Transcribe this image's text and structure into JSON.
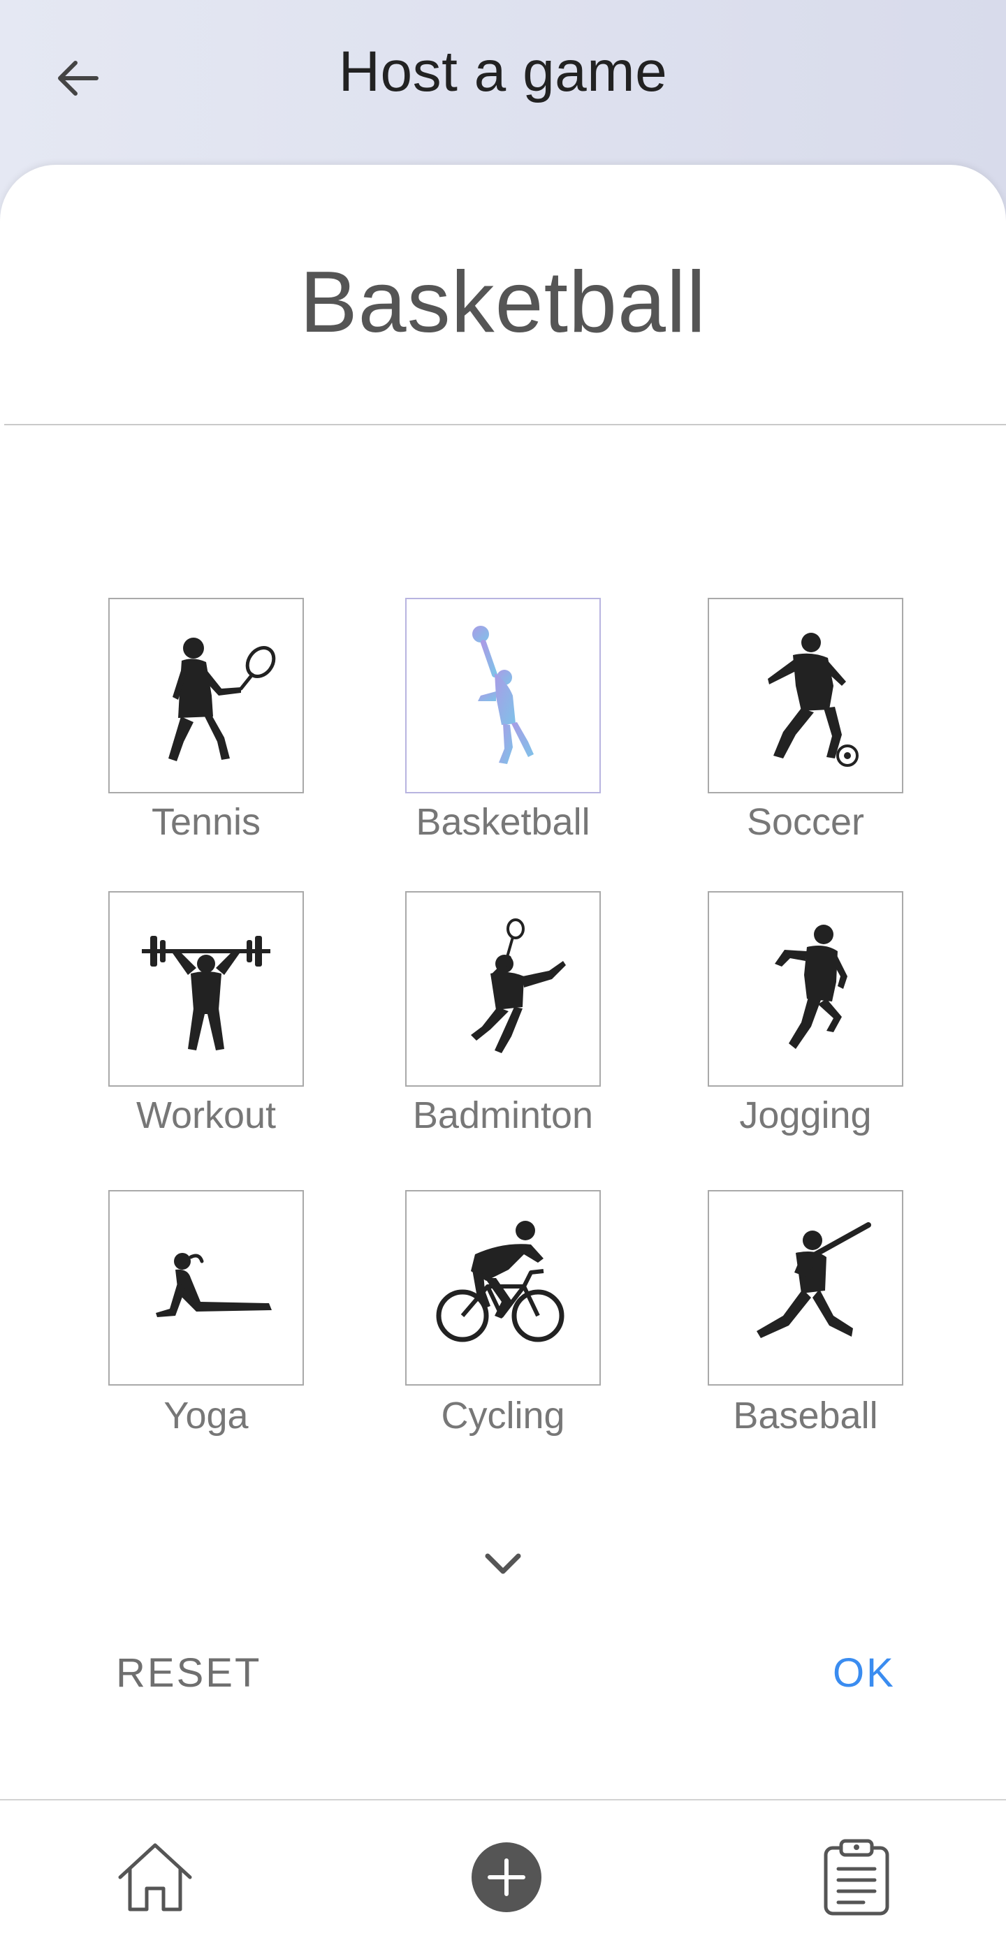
{
  "header": {
    "title": "Host a game",
    "back_icon": "arrow-left-icon"
  },
  "selected_sport": "Basketball",
  "sports": [
    {
      "label": "Tennis",
      "icon": "tennis-player-icon",
      "selected": false
    },
    {
      "label": "Basketball",
      "icon": "basketball-player-icon",
      "selected": true
    },
    {
      "label": "Soccer",
      "icon": "soccer-player-icon",
      "selected": false
    },
    {
      "label": "Workout",
      "icon": "weightlifter-icon",
      "selected": false
    },
    {
      "label": "Badminton",
      "icon": "badminton-player-icon",
      "selected": false
    },
    {
      "label": "Jogging",
      "icon": "runner-icon",
      "selected": false
    },
    {
      "label": "Yoga",
      "icon": "yoga-pose-icon",
      "selected": false
    },
    {
      "label": "Cycling",
      "icon": "cyclist-icon",
      "selected": false
    },
    {
      "label": "Baseball",
      "icon": "baseball-batter-icon",
      "selected": false
    }
  ],
  "more_icon": "chevron-down-icon",
  "actions": {
    "reset_label": "RESET",
    "ok_label": "OK"
  },
  "bottom_nav": [
    {
      "icon": "home-icon"
    },
    {
      "icon": "add-circle-icon"
    },
    {
      "icon": "clipboard-icon"
    }
  ],
  "colors": {
    "accent": "#3a8cf0",
    "selected_gradient_start": "#a99ce6",
    "selected_gradient_end": "#7fc2e8",
    "silhouette": "#222222",
    "header_bg_start": "#e5e8f3",
    "header_bg_end": "#d8dbeb"
  }
}
